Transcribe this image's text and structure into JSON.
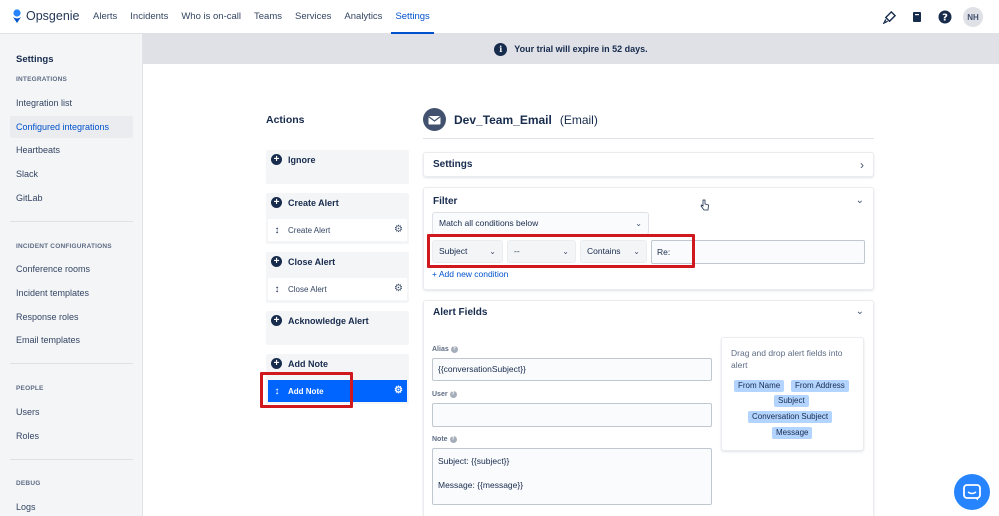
{
  "app": {
    "name": "Opsgenie"
  },
  "nav": {
    "items": [
      "Alerts",
      "Incidents",
      "Who is on-call",
      "Teams",
      "Services",
      "Analytics",
      "Settings"
    ],
    "active": "Settings"
  },
  "user": {
    "initials": "NH"
  },
  "banner": {
    "text": "Your trial will expire in 52 days."
  },
  "sidebar": {
    "title": "Settings",
    "sections": [
      {
        "heading": "INTEGRATIONS",
        "items": [
          "Integration list",
          "Configured integrations",
          "Heartbeats",
          "Slack",
          "GitLab"
        ],
        "selected": "Configured integrations"
      },
      {
        "heading": "INCIDENT CONFIGURATIONS",
        "items": [
          "Conference rooms",
          "Incident templates",
          "Response roles",
          "Email templates"
        ]
      },
      {
        "heading": "PEOPLE",
        "items": [
          "Users",
          "Roles"
        ]
      },
      {
        "heading": "DEBUG",
        "items": [
          "Logs"
        ]
      }
    ]
  },
  "actions": {
    "title": "Actions",
    "groups": [
      {
        "label": "Ignore",
        "rows": []
      },
      {
        "label": "Create Alert",
        "rows": [
          "Create Alert"
        ]
      },
      {
        "label": "Close Alert",
        "rows": [
          "Close Alert"
        ]
      },
      {
        "label": "Acknowledge Alert",
        "rows": []
      },
      {
        "label": "Add Note",
        "rows": [
          "Add Note"
        ],
        "selected_row": "Add Note"
      }
    ]
  },
  "integration": {
    "name": "Dev_Team_Email",
    "type": "(Email)"
  },
  "settings_card": {
    "title": "Settings"
  },
  "filter": {
    "title": "Filter",
    "match": "Match all conditions below",
    "condition": {
      "field": "Subject",
      "operator_not": "--",
      "operator": "Contains",
      "value": "Re:"
    },
    "add_condition": "+ Add new condition"
  },
  "alert_fields": {
    "title": "Alert Fields",
    "alias_label": "Alias",
    "alias_value": "{{conversationSubject}}",
    "user_label": "User",
    "user_value": "",
    "note_label": "Note",
    "note_line1": "Subject: {{subject}}",
    "note_line2": "Message: {{message}}",
    "drag_hint": "Drag and drop alert fields into alert",
    "tags": [
      "From Name",
      "From Address",
      "Subject",
      "Conversation Subject",
      "Message"
    ]
  },
  "colors": {
    "accent": "#0052cc",
    "selected_row": "#0065ff",
    "highlight": "#d0191f",
    "banner": "#dfe1e6"
  },
  "icons": [
    "opsgenie-logo-icon",
    "rocket-icon",
    "book-icon",
    "help-icon",
    "info-icon",
    "plus-circle-icon",
    "drag-handle-icon",
    "gear-icon",
    "email-integration-icon",
    "chevron-right-icon",
    "chevron-down-icon",
    "caret-down-icon",
    "question-icon",
    "chat-icon"
  ]
}
